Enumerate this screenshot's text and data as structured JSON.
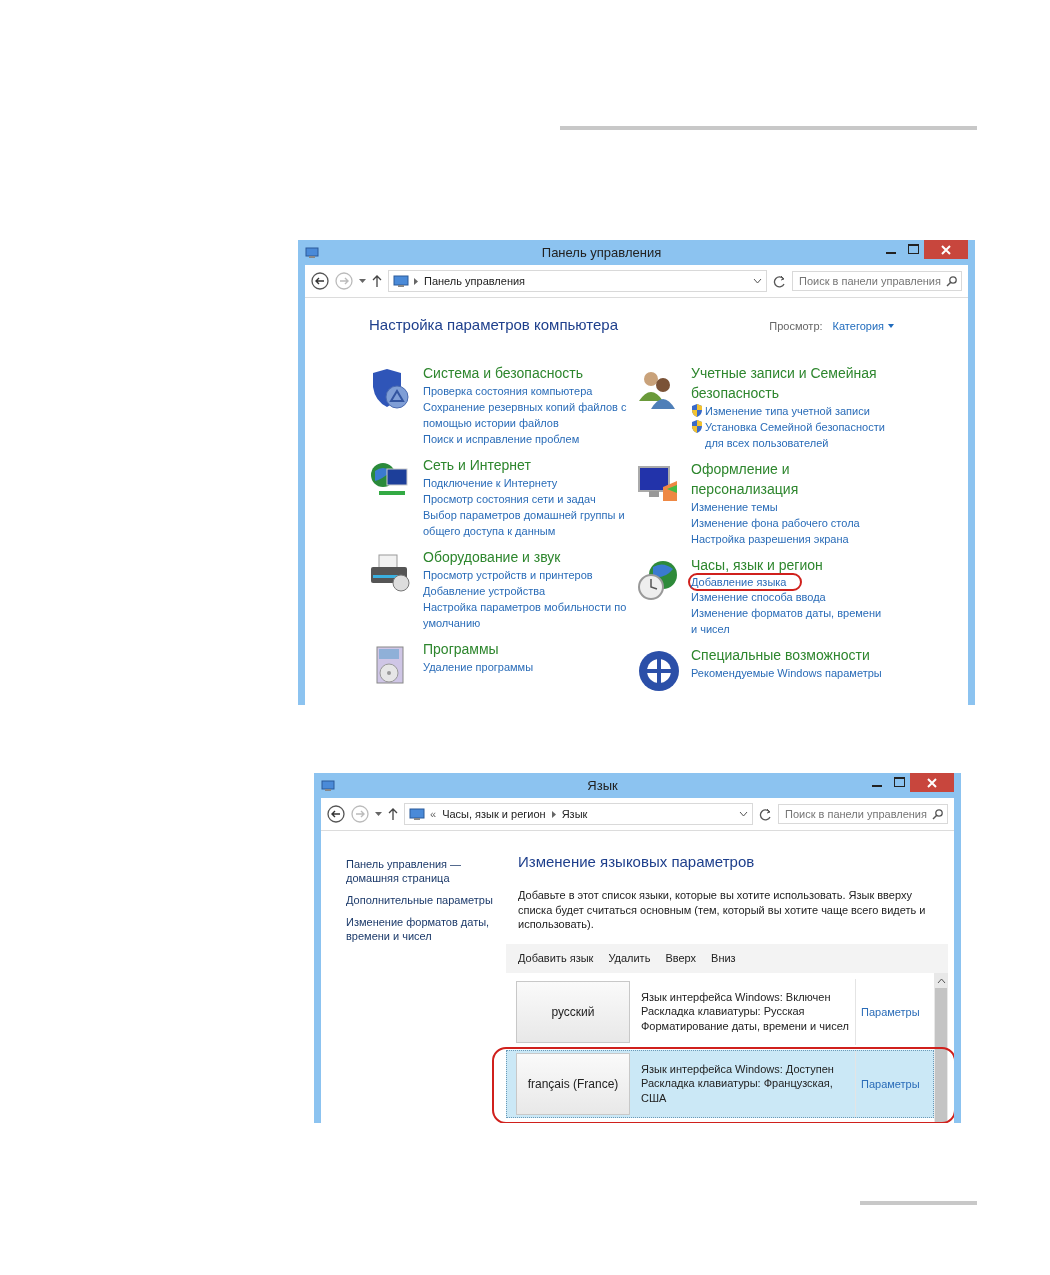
{
  "control_panel_window": {
    "title": "Панель управления",
    "breadcrumb": [
      "Панель управления"
    ],
    "search": {
      "placeholder": "Поиск в панели управления"
    },
    "heading": "Настройка параметров компьютера",
    "view": {
      "label": "Просмотр:",
      "value": "Категория"
    },
    "columns": [
      [
        {
          "kind": "security",
          "title": "Система и безопасность",
          "links": [
            {
              "text": "Проверка состояния компьютера",
              "shield": false,
              "highlighted": false
            },
            {
              "text": "Сохранение резервных копий файлов с помощью истории файлов",
              "shield": false,
              "highlighted": false
            },
            {
              "text": "Поиск и исправление проблем",
              "shield": false,
              "highlighted": false
            }
          ]
        },
        {
          "kind": "network",
          "title": "Сеть и Интернет",
          "links": [
            {
              "text": "Подключение к Интернету",
              "shield": false,
              "highlighted": false
            },
            {
              "text": "Просмотр состояния сети и задач",
              "shield": false,
              "highlighted": false
            },
            {
              "text": "Выбор параметров домашней группы и общего доступа к данным",
              "shield": false,
              "highlighted": false
            }
          ]
        },
        {
          "kind": "hardware",
          "title": "Оборудование и звук",
          "links": [
            {
              "text": "Просмотр устройств и принтеров",
              "shield": false,
              "highlighted": false
            },
            {
              "text": "Добавление устройства",
              "shield": false,
              "highlighted": false
            },
            {
              "text": "Настройка параметров мобильности по умолчанию",
              "shield": false,
              "highlighted": false
            }
          ]
        },
        {
          "kind": "programs",
          "title": "Программы",
          "links": [
            {
              "text": "Удаление программы",
              "shield": false,
              "highlighted": false
            }
          ]
        }
      ],
      [
        {
          "kind": "accounts",
          "title": "Учетные записи и Семейная безопасность",
          "links": [
            {
              "text": "Изменение типа учетной записи",
              "shield": true,
              "highlighted": false
            },
            {
              "text": "Установка Семейной безопасности для всех пользователей",
              "shield": true,
              "highlighted": false
            }
          ]
        },
        {
          "kind": "appearance",
          "title": "Оформление и персонализация",
          "links": [
            {
              "text": "Изменение темы",
              "shield": false,
              "highlighted": false
            },
            {
              "text": "Изменение фона рабочего стола",
              "shield": false,
              "highlighted": false
            },
            {
              "text": "Настройка разрешения экрана",
              "shield": false,
              "highlighted": false
            }
          ]
        },
        {
          "kind": "clock",
          "title": "Часы, язык и регион",
          "links": [
            {
              "text": "Добавление языка",
              "shield": false,
              "highlighted": true
            },
            {
              "text": "Изменение способа ввода",
              "shield": false,
              "highlighted": false
            },
            {
              "text": "Изменение форматов даты, времени и чисел",
              "shield": false,
              "highlighted": false
            }
          ]
        },
        {
          "kind": "accessibility",
          "title": "Специальные возможности",
          "links": [
            {
              "text": "Рекомендуемые Windows параметры",
              "shield": false,
              "highlighted": false
            }
          ]
        }
      ]
    ]
  },
  "language_window": {
    "title": "Язык",
    "overflow_mark": "«",
    "breadcrumb": [
      "Часы, язык и регион",
      "Язык"
    ],
    "search": {
      "placeholder": "Поиск в панели управления"
    },
    "nav_links": [
      "Панель управления — домашняя страница",
      "Дополнительные параметры",
      "Изменение форматов даты, времени и чисел"
    ],
    "heading": "Изменение языковых параметров",
    "description": "Добавьте в этот список языки, которые вы хотите использовать. Язык вверху списка будет считаться основным (тем, который вы хотите чаще всего видеть и использовать).",
    "toolbar": [
      "Добавить язык",
      "Удалить",
      "Вверх",
      "Вниз"
    ],
    "languages": [
      {
        "name": "русский",
        "details": [
          "Язык интерфейса Windows: Включен",
          "Раскладка клавиатуры: Русская",
          "Форматирование даты, времени и чисел"
        ],
        "options": "Параметры",
        "selected": false,
        "highlighted": false
      },
      {
        "name": "français (France)",
        "details": [
          "Язык интерфейса Windows: Доступен",
          "Раскладка клавиатуры: Французская, США"
        ],
        "options": "Параметры",
        "selected": true,
        "highlighted": true
      }
    ]
  }
}
